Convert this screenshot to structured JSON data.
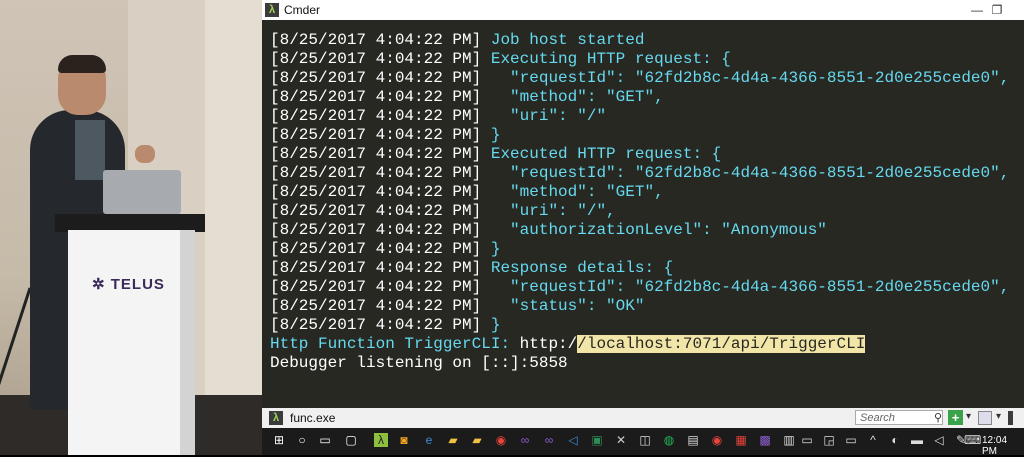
{
  "stage": {
    "podium_logo": "TELUS"
  },
  "window": {
    "title": "Cmder",
    "controls": [
      "minimize",
      "restore"
    ]
  },
  "console": {
    "lines": [
      {
        "ts": "[8/25/2017 4:04:22 PM]",
        "text": " Job host started"
      },
      {
        "ts": "[8/25/2017 4:04:22 PM]",
        "text": " Executing HTTP request: {"
      },
      {
        "ts": "[8/25/2017 4:04:22 PM]",
        "text": "   \"requestId\": \"62fd2b8c-4d4a-4366-8551-2d0e255cede0\","
      },
      {
        "ts": "[8/25/2017 4:04:22 PM]",
        "text": "   \"method\": \"GET\","
      },
      {
        "ts": "[8/25/2017 4:04:22 PM]",
        "text": "   \"uri\": \"/\""
      },
      {
        "ts": "[8/25/2017 4:04:22 PM]",
        "text": " }"
      },
      {
        "ts": "[8/25/2017 4:04:22 PM]",
        "text": " Executed HTTP request: {"
      },
      {
        "ts": "[8/25/2017 4:04:22 PM]",
        "text": "   \"requestId\": \"62fd2b8c-4d4a-4366-8551-2d0e255cede0\","
      },
      {
        "ts": "[8/25/2017 4:04:22 PM]",
        "text": "   \"method\": \"GET\","
      },
      {
        "ts": "[8/25/2017 4:04:22 PM]",
        "text": "   \"uri\": \"/\","
      },
      {
        "ts": "[8/25/2017 4:04:22 PM]",
        "text": "   \"authorizationLevel\": \"Anonymous\""
      },
      {
        "ts": "[8/25/2017 4:04:22 PM]",
        "text": " }"
      },
      {
        "ts": "[8/25/2017 4:04:22 PM]",
        "text": " Response details: {"
      },
      {
        "ts": "[8/25/2017 4:04:22 PM]",
        "text": "   \"requestId\": \"62fd2b8c-4d4a-4366-8551-2d0e255cede0\","
      },
      {
        "ts": "[8/25/2017 4:04:22 PM]",
        "text": "   \"status\": \"OK\""
      },
      {
        "ts": "[8/25/2017 4:04:22 PM]",
        "text": " }"
      }
    ],
    "http_function_label": "Http Function TriggerCLI:",
    "url_prefix": " http:/",
    "url_selected": "/localhost:7071/api/TriggerCLI",
    "debugger_line": "Debugger listening on [::]:5858"
  },
  "tabbar": {
    "tab_label": "func.exe",
    "search_placeholder": "Search"
  },
  "taskbar": {
    "clock": "12:04 PM"
  },
  "colors": {
    "console_bg": "#272822",
    "log_text": "#66d9ef",
    "selection": "#f1e6a8",
    "cmder_accent": "#9fd356"
  }
}
